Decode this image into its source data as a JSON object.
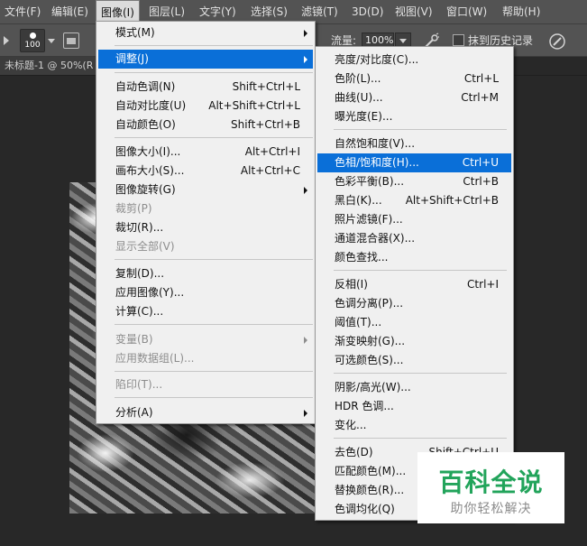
{
  "menubar": {
    "items": [
      "文件(F)",
      "编辑(E)",
      "图像(I)",
      "图层(L)",
      "文字(Y)",
      "选择(S)",
      "滤镜(T)",
      "3D(D)",
      "视图(V)",
      "窗口(W)",
      "帮助(H)"
    ],
    "active": "图像(I)"
  },
  "options": {
    "brush_size": "100",
    "flow_label": "流量:",
    "flow_value": "100%",
    "history_label": "抹到历史记录"
  },
  "document": {
    "tab_title": "未标题-1 @ 50%(R"
  },
  "image_menu": {
    "items": [
      {
        "label": "模式(M)",
        "shortcut": "",
        "submenu": true,
        "disabled": false
      },
      {
        "label": "调整(J)",
        "shortcut": "",
        "submenu": true,
        "disabled": false,
        "highlighted": true
      },
      {
        "label": "自动色调(N)",
        "shortcut": "Shift+Ctrl+L",
        "submenu": false,
        "disabled": false
      },
      {
        "label": "自动对比度(U)",
        "shortcut": "Alt+Shift+Ctrl+L",
        "submenu": false,
        "disabled": false
      },
      {
        "label": "自动颜色(O)",
        "shortcut": "Shift+Ctrl+B",
        "submenu": false,
        "disabled": false
      },
      {
        "label": "图像大小(I)...",
        "shortcut": "Alt+Ctrl+I",
        "submenu": false,
        "disabled": false
      },
      {
        "label": "画布大小(S)...",
        "shortcut": "Alt+Ctrl+C",
        "submenu": false,
        "disabled": false
      },
      {
        "label": "图像旋转(G)",
        "shortcut": "",
        "submenu": true,
        "disabled": false
      },
      {
        "label": "裁剪(P)",
        "shortcut": "",
        "submenu": false,
        "disabled": true
      },
      {
        "label": "裁切(R)...",
        "shortcut": "",
        "submenu": false,
        "disabled": false
      },
      {
        "label": "显示全部(V)",
        "shortcut": "",
        "submenu": false,
        "disabled": true
      },
      {
        "label": "复制(D)...",
        "shortcut": "",
        "submenu": false,
        "disabled": false
      },
      {
        "label": "应用图像(Y)...",
        "shortcut": "",
        "submenu": false,
        "disabled": false
      },
      {
        "label": "计算(C)...",
        "shortcut": "",
        "submenu": false,
        "disabled": false
      },
      {
        "label": "变量(B)",
        "shortcut": "",
        "submenu": true,
        "disabled": true
      },
      {
        "label": "应用数据组(L)...",
        "shortcut": "",
        "submenu": false,
        "disabled": true
      },
      {
        "label": "陷印(T)...",
        "shortcut": "",
        "submenu": false,
        "disabled": true
      },
      {
        "label": "分析(A)",
        "shortcut": "",
        "submenu": true,
        "disabled": false
      }
    ]
  },
  "adjust_menu": {
    "items": [
      {
        "label": "亮度/对比度(C)...",
        "shortcut": ""
      },
      {
        "label": "色阶(L)...",
        "shortcut": "Ctrl+L"
      },
      {
        "label": "曲线(U)...",
        "shortcut": "Ctrl+M"
      },
      {
        "label": "曝光度(E)...",
        "shortcut": ""
      },
      {
        "label": "自然饱和度(V)...",
        "shortcut": ""
      },
      {
        "label": "色相/饱和度(H)...",
        "shortcut": "Ctrl+U",
        "highlighted": true
      },
      {
        "label": "色彩平衡(B)...",
        "shortcut": "Ctrl+B"
      },
      {
        "label": "黑白(K)...",
        "shortcut": "Alt+Shift+Ctrl+B"
      },
      {
        "label": "照片滤镜(F)...",
        "shortcut": ""
      },
      {
        "label": "通道混合器(X)...",
        "shortcut": ""
      },
      {
        "label": "颜色查找...",
        "shortcut": ""
      },
      {
        "label": "反相(I)",
        "shortcut": "Ctrl+I"
      },
      {
        "label": "色调分离(P)...",
        "shortcut": ""
      },
      {
        "label": "阈值(T)...",
        "shortcut": ""
      },
      {
        "label": "渐变映射(G)...",
        "shortcut": ""
      },
      {
        "label": "可选颜色(S)...",
        "shortcut": ""
      },
      {
        "label": "阴影/高光(W)...",
        "shortcut": ""
      },
      {
        "label": "HDR 色调...",
        "shortcut": ""
      },
      {
        "label": "变化...",
        "shortcut": ""
      },
      {
        "label": "去色(D)",
        "shortcut": "Shift+Ctrl+U"
      },
      {
        "label": "匹配颜色(M)...",
        "shortcut": ""
      },
      {
        "label": "替换颜色(R)...",
        "shortcut": ""
      },
      {
        "label": "色调均化(Q)",
        "shortcut": ""
      }
    ]
  },
  "watermark": {
    "title": "百科全说",
    "subtitle": "助你轻松解决",
    "color": "#22a45b"
  },
  "colors": {
    "highlight": "#0a6fd8",
    "menu_bg": "#f0f0f0",
    "chrome": "#535353"
  }
}
